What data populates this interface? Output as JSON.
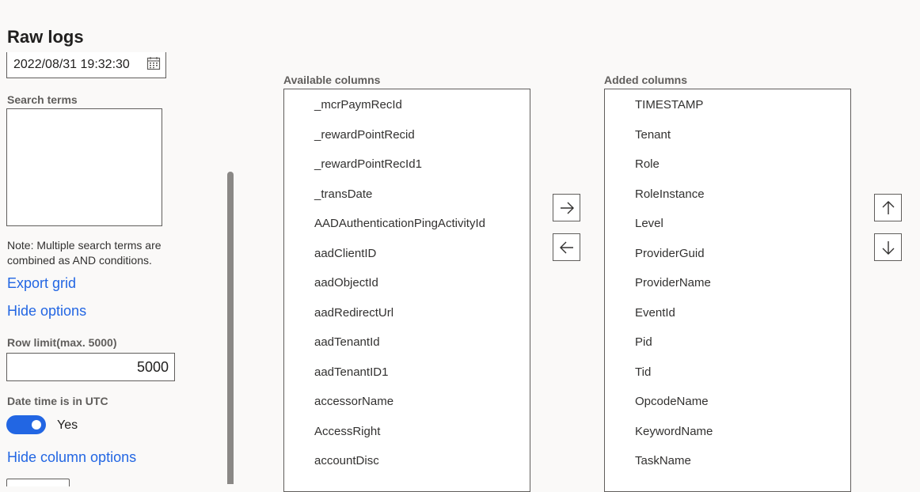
{
  "page": {
    "title": "Raw logs"
  },
  "filters": {
    "date_value": "2022/08/31 19:32:30",
    "date_icon": "calendar-icon",
    "search_terms_label": "Search terms",
    "search_terms_value": "",
    "note_line1": "Note: Multiple search terms are",
    "note_line2": "combined as AND conditions.",
    "export_grid": "Export grid",
    "hide_options": "Hide options",
    "row_limit_label": "Row limit(max. 5000)",
    "row_limit_value": "5000",
    "utc_label": "Date time is in UTC",
    "utc_toggle": true,
    "utc_toggle_text": "Yes",
    "hide_column_options": "Hide column options"
  },
  "columns": {
    "available_label": "Available columns",
    "added_label": "Added columns",
    "available": [
      "_mcrPaymRecId",
      "_rewardPointRecid",
      "_rewardPointRecId1",
      "_transDate",
      "AADAuthenticationPingActivityId",
      "aadClientID",
      "aadObjectId",
      "aadRedirectUrl",
      "aadTenantId",
      "aadTenantID1",
      "accessorName",
      "AccessRight",
      "accountDisc"
    ],
    "added": [
      "TIMESTAMP",
      "Tenant",
      "Role",
      "RoleInstance",
      "Level",
      "ProviderGuid",
      "ProviderName",
      "EventId",
      "Pid",
      "Tid",
      "OpcodeName",
      "KeywordName",
      "TaskName"
    ]
  },
  "buttons": {
    "add_icon": "arrow-right-icon",
    "remove_icon": "arrow-left-icon",
    "move_up_icon": "arrow-up-icon",
    "move_down_icon": "arrow-down-icon"
  }
}
